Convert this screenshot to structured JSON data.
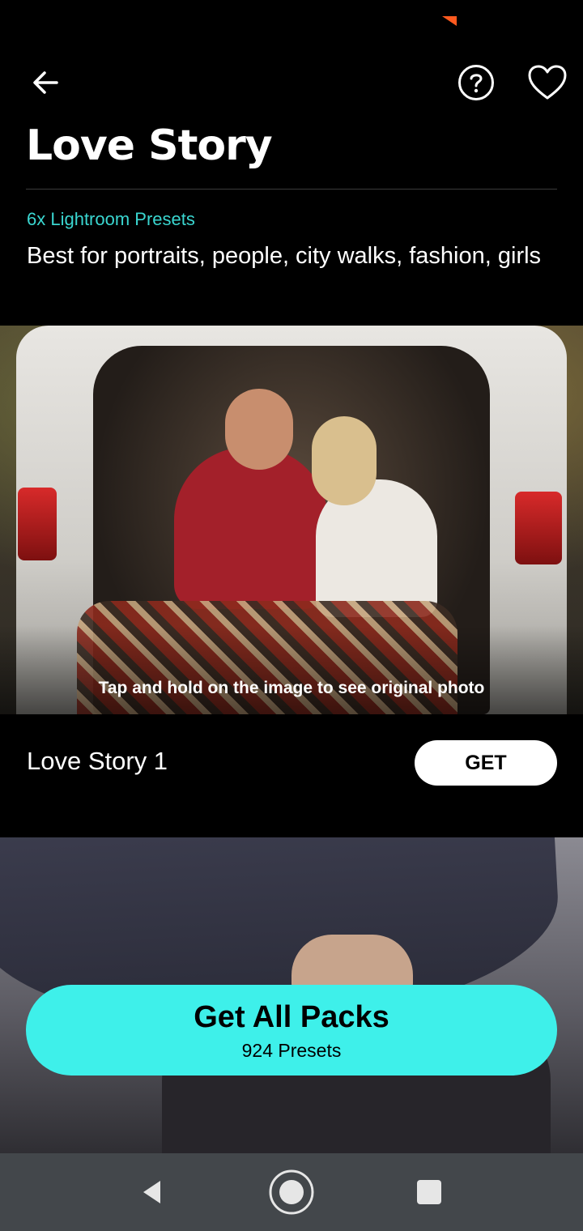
{
  "header": {
    "title": "Love Story",
    "back_icon": "arrow-left-icon",
    "help_icon": "help-circle-icon",
    "favorite_icon": "heart-outline-icon"
  },
  "pack": {
    "subtitle": "6x Lightroom Presets",
    "description": "Best for portraits, people, city walks, fashion, girls"
  },
  "preset": {
    "hint": "Tap and hold on the image to see original photo",
    "name": "Love Story 1",
    "get_label": "GET"
  },
  "cta": {
    "title": "Get All Packs",
    "subtitle": "924 Presets"
  },
  "colors": {
    "accent": "#3ef0ea",
    "subtitle": "#3ad6d0",
    "background": "#000000",
    "navbar": "#43474b"
  },
  "system_nav": {
    "back_icon": "nav-back-triangle-icon",
    "home_icon": "nav-home-circle-icon",
    "recents_icon": "nav-recents-square-icon"
  }
}
